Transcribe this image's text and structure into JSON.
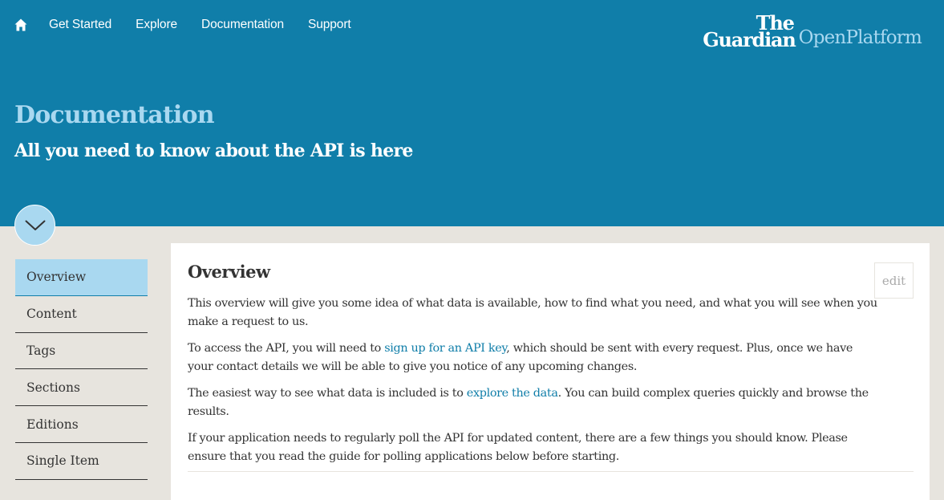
{
  "nav": {
    "home_icon": "home-icon",
    "links": [
      "Get Started",
      "Explore",
      "Documentation",
      "Support"
    ]
  },
  "brand": {
    "the": "The",
    "guardian": "Guardian",
    "platform": "OpenPlatform"
  },
  "header": {
    "title": "Documentation",
    "subtitle": "All you need to know about the API is here",
    "toggle_icon": "chevron-down-icon"
  },
  "sidebar": {
    "items": [
      {
        "label": "Overview",
        "active": true
      },
      {
        "label": "Content",
        "active": false
      },
      {
        "label": "Tags",
        "active": false
      },
      {
        "label": "Sections",
        "active": false
      },
      {
        "label": "Editions",
        "active": false
      },
      {
        "label": "Single Item",
        "active": false
      }
    ]
  },
  "main": {
    "title": "Overview",
    "edit_label": "edit",
    "p1": "This overview will give you some idea of what data is available, how to find what you need, and what you will see when you make a request to us.",
    "p2_before": "To access the API, you will need to ",
    "p2_link": "sign up for an API key",
    "p2_after": ", which should be sent with every request. Plus, once we have your contact details we will be able to give you notice of any upcoming changes.",
    "p3_before": "The easiest way to see what data is included is to ",
    "p3_link": "explore the data",
    "p3_after": ". You can build complex queries quickly and browse the results.",
    "p4": "If your application needs to regularly poll the API for updated content, there are a few things you should know. Please ensure that you read the guide for polling applications below before starting."
  },
  "colors": {
    "header_bg": "#107ea9",
    "accent_light": "#a9d8f0",
    "page_bg": "#e7e4de",
    "text": "#333333",
    "link": "#107ea9"
  }
}
